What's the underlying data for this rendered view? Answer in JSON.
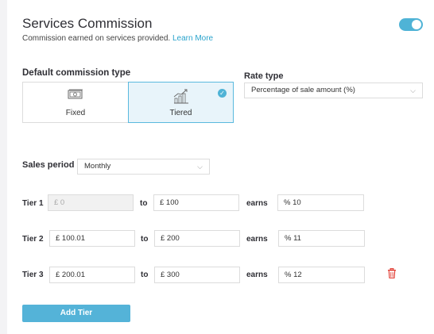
{
  "header": {
    "title": "Services Commission",
    "subtitle": "Commission earned on services provided.",
    "learn_more": "Learn More",
    "toggle_on": true
  },
  "commission_type": {
    "label": "Default commission type",
    "options": [
      {
        "label": "Fixed",
        "icon": "cash-icon",
        "selected": false
      },
      {
        "label": "Tiered",
        "icon": "growth-chart-icon",
        "selected": true
      }
    ]
  },
  "rate_type": {
    "label": "Rate type",
    "value": "Percentage of sale amount (%)"
  },
  "sales_period": {
    "label": "Sales period",
    "value": "Monthly"
  },
  "tiers": [
    {
      "label": "Tier 1",
      "from": "£ 0",
      "to_word": "to",
      "to": "£ 100",
      "earns_word": "earns",
      "rate": "% 10"
    },
    {
      "label": "Tier 2",
      "from": "£ 100.01",
      "to_word": "to",
      "to": "£ 200",
      "earns_word": "earns",
      "rate": "% 11"
    },
    {
      "label": "Tier 3",
      "from": "£ 200.01",
      "to_word": "to",
      "to": "£ 300",
      "earns_word": "earns",
      "rate": "% 12"
    }
  ],
  "add_tier_label": "Add Tier",
  "colors": {
    "accent": "#4fb3d6",
    "delete": "#e0342a",
    "selected_bg": "#e8f4fa"
  }
}
